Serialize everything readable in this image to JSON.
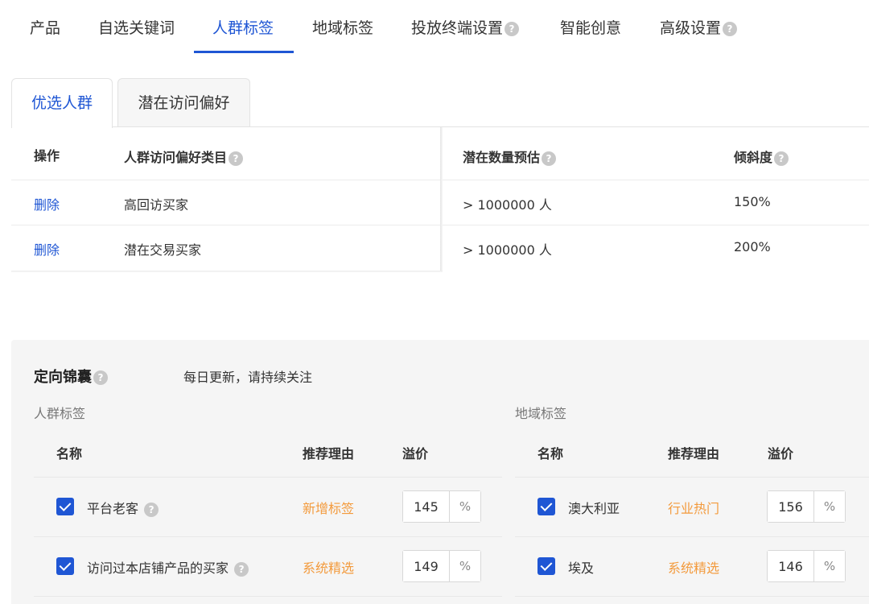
{
  "top_tabs": [
    {
      "label": "产品",
      "help": false
    },
    {
      "label": "自选关键词",
      "help": false
    },
    {
      "label": "人群标签",
      "help": false,
      "active": true
    },
    {
      "label": "地域标签",
      "help": false
    },
    {
      "label": "投放终端设置",
      "help": true
    },
    {
      "label": "智能创意",
      "help": false
    },
    {
      "label": "高级设置",
      "help": true
    }
  ],
  "sub_tabs": [
    "优选人群",
    "潜在访问偏好"
  ],
  "selected_table": {
    "headers": {
      "action": "操作",
      "category": "人群访问偏好类目",
      "estimate": "潜在数量预估",
      "tilt": "倾斜度"
    },
    "rows": [
      {
        "action": "删除",
        "category": "高回访买家",
        "estimate": "> 1000000 人",
        "tilt": "150%"
      },
      {
        "action": "删除",
        "category": "潜在交易买家",
        "estimate": "> 1000000 人",
        "tilt": "200%"
      }
    ]
  },
  "panel": {
    "title": "定向锦囊",
    "note": "每日更新，请持续关注",
    "audience": {
      "section_label": "人群标签",
      "headers": {
        "name": "名称",
        "reason": "推荐理由",
        "premium": "溢价"
      },
      "rows": [
        {
          "name": "平台老客",
          "help": true,
          "reason": "新增标签",
          "premium": "145",
          "unit": "%",
          "checked": true
        },
        {
          "name": "访问过本店铺产品的买家",
          "help": true,
          "reason": "系统精选",
          "premium": "149",
          "unit": "%",
          "checked": true
        }
      ]
    },
    "region": {
      "section_label": "地域标签",
      "headers": {
        "name": "名称",
        "reason": "推荐理由",
        "premium": "溢价"
      },
      "rows": [
        {
          "name": "澳大利亚",
          "reason": "行业热门",
          "premium": "156",
          "unit": "%",
          "checked": true
        },
        {
          "name": "埃及",
          "reason": "系统精选",
          "premium": "146",
          "unit": "%",
          "checked": true
        }
      ]
    }
  },
  "colors": {
    "accent": "#1f56d4",
    "reason": "#f39a3c",
    "panel_bg": "#f5f5f5"
  },
  "icons": {
    "help": "question-circle-icon",
    "checkbox": "checkbox-checked-icon"
  }
}
